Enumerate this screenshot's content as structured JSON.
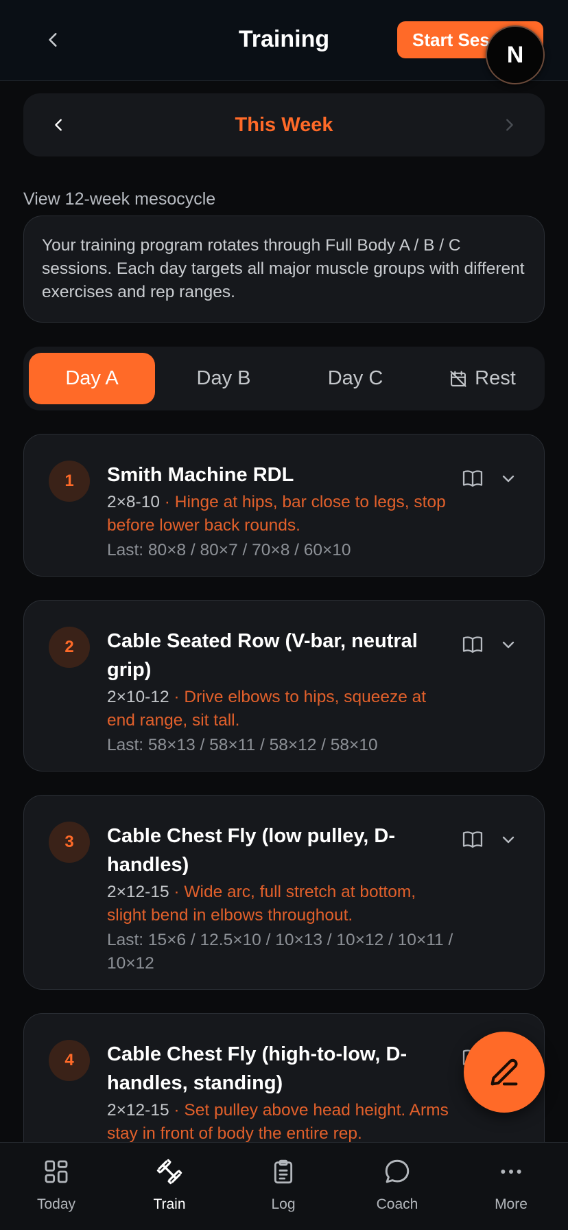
{
  "header": {
    "title": "Training",
    "start_label": "Start Session",
    "avatar_letter": "N"
  },
  "week": {
    "label": "This Week"
  },
  "mesocycle_link": "View 12-week mesocycle",
  "info_text": "Your training program rotates through Full Body A / B / C sessions. Each day targets all major muscle groups with different exercises and rep ranges.",
  "tabs": [
    {
      "label": "Day A",
      "active": true
    },
    {
      "label": "Day B",
      "active": false
    },
    {
      "label": "Day C",
      "active": false
    },
    {
      "label": "Rest",
      "active": false
    }
  ],
  "exercises": [
    {
      "number": "1",
      "name": "Smith Machine RDL",
      "sets": "2×8-10",
      "cue": " · Hinge at hips, bar close to legs, stop before lower back rounds.",
      "last": "Last: 80×8 / 80×7 / 70×8 / 60×10"
    },
    {
      "number": "2",
      "name": "Cable Seated Row (V-bar, neutral grip)",
      "sets": "2×10-12",
      "cue": " · Drive elbows to hips, squeeze at end range, sit tall.",
      "last": "Last: 58×13 / 58×11 / 58×12 / 58×10"
    },
    {
      "number": "3",
      "name": "Cable Chest Fly (low pulley, D-handles)",
      "sets": "2×12-15",
      "cue": " · Wide arc, full stretch at bottom, slight bend in elbows throughout.",
      "last": "Last: 15×6 / 12.5×10 / 10×13 / 10×12 / 10×11 / 10×12"
    },
    {
      "number": "4",
      "name": "Cable Chest Fly (high-to-low, D-handles, standing)",
      "sets": "2×12-15",
      "cue": " · Set pulley above head height. Arms stay in front of body the entire rep.",
      "last": ""
    }
  ],
  "bottom_nav": [
    {
      "label": "Today",
      "icon": "grid-icon",
      "active": false
    },
    {
      "label": "Train",
      "icon": "dumbbell-icon",
      "active": true
    },
    {
      "label": "Log",
      "icon": "clipboard-icon",
      "active": false
    },
    {
      "label": "Coach",
      "icon": "chat-bubble-icon",
      "active": false
    },
    {
      "label": "More",
      "icon": "more-dots-icon",
      "active": false
    }
  ],
  "colors": {
    "accent": "#ff6a28",
    "background": "#0a0b0d",
    "card": "#16181c"
  }
}
